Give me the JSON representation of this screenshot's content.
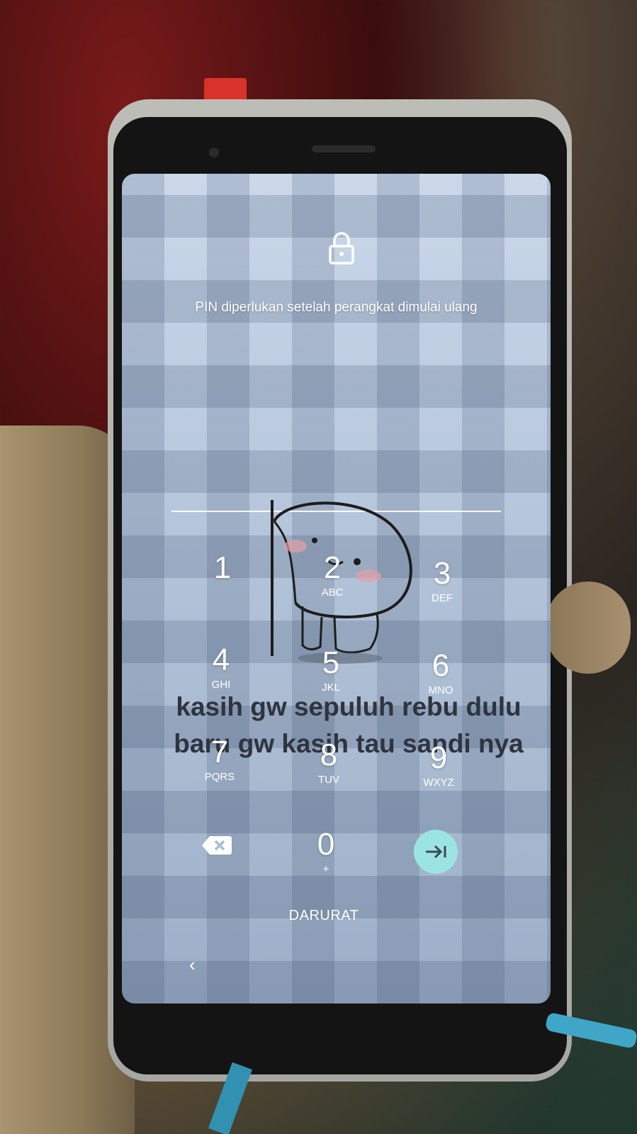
{
  "lockscreen": {
    "prompt": "PIN diperlukan setelah perangkat dimulai ulang",
    "emergency_label": "DARURAT",
    "back_symbol": "‹"
  },
  "keypad": {
    "keys": [
      {
        "digit": "1",
        "letters": ""
      },
      {
        "digit": "2",
        "letters": "ABC"
      },
      {
        "digit": "3",
        "letters": "DEF"
      },
      {
        "digit": "4",
        "letters": "GHI"
      },
      {
        "digit": "5",
        "letters": "JKL"
      },
      {
        "digit": "6",
        "letters": "MNO"
      },
      {
        "digit": "7",
        "letters": "PQRS"
      },
      {
        "digit": "8",
        "letters": "TUV"
      },
      {
        "digit": "9",
        "letters": "WXYZ"
      },
      {
        "digit": "0",
        "letters": "+"
      }
    ],
    "backspace_icon": "backspace-icon",
    "enter_icon": "enter-arrow-icon"
  },
  "wallpaper_caption": {
    "line1": "kasih gw sepuluh rebu dulu",
    "line2": "baru gw kasih tau sandi nya"
  },
  "colors": {
    "enter_button": "#9ce4e4",
    "caption_text": "#2e3440"
  }
}
